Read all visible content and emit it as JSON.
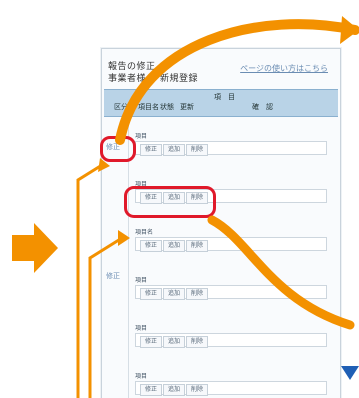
{
  "panel": {
    "title_line1": "報告の修正",
    "title_line2": "事業者様",
    "title_tab2": "新規登録",
    "link_text": "ページの使い方はこちら",
    "header_top": "項　目",
    "header_cols": [
      "区分",
      "項目名",
      "状態",
      "更新",
      "確　認"
    ],
    "rows": [
      {
        "label": "項目",
        "btns": [
          "修正",
          "追加",
          "削除"
        ]
      },
      {
        "label": "項目",
        "btns": [
          "修正",
          "追加",
          "削除"
        ]
      },
      {
        "label": "項目名",
        "btns": [
          "修正",
          "追加",
          "削除"
        ]
      },
      {
        "label": "項目",
        "btns": [
          "修正",
          "追加",
          "削除"
        ]
      },
      {
        "label": "項目",
        "btns": [
          "修正",
          "追加",
          "削除"
        ]
      },
      {
        "label": "項目",
        "btns": [
          "修正",
          "追加",
          "削除"
        ]
      }
    ],
    "side_labels": [
      "修正",
      "修正"
    ]
  },
  "colors": {
    "arrow_orange": "#f39100",
    "highlight_red": "#e0192a",
    "header_blue": "#b9d3e7",
    "corner_blue": "#1f5fb5"
  }
}
